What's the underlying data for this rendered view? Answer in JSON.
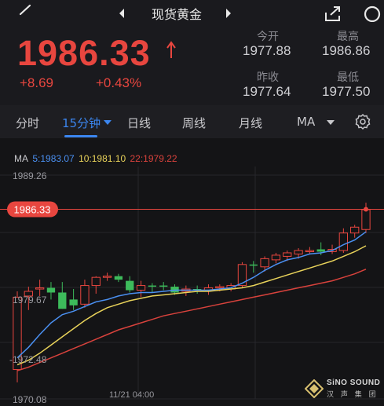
{
  "header": {
    "title": "现货黄金"
  },
  "quote": {
    "price": "1986.33",
    "change": "+8.69",
    "change_pct": "+0.43%",
    "stats": [
      {
        "label": "今开",
        "value": "1977.88"
      },
      {
        "label": "最高",
        "value": "1986.86"
      },
      {
        "label": "昨收",
        "value": "1977.64"
      },
      {
        "label": "最低",
        "value": "1977.50"
      }
    ]
  },
  "tabs": {
    "items": [
      "分时",
      "15分钟",
      "日线",
      "周线",
      "月线",
      "MA"
    ],
    "active": "15分钟"
  },
  "colors": {
    "up": "#e8463f",
    "down": "#3dbb5b",
    "accent": "#3b86f0",
    "ma5": "#4a8ff0",
    "ma10": "#e8d25a",
    "ma22": "#d8423c"
  },
  "ma_legend": {
    "ma_label": "MA",
    "ma5": "5:1983.07",
    "ma10": "10:1981.10",
    "ma22": "22:1979.22"
  },
  "chart_data": {
    "type": "candlestick",
    "y_ticks": [
      "1989.26",
      "1979.67",
      "1972.48",
      "1970.08"
    ],
    "x_ticks": [
      "11/21 04:00"
    ],
    "last_price_label": "1986.33",
    "last_price": 1986.33,
    "ylim": [
      1970.08,
      1989.26
    ],
    "candles": [
      {
        "open": 1972.6,
        "high": 1979.3,
        "low": 1971.5,
        "close": 1978.8
      },
      {
        "open": 1978.9,
        "high": 1979.7,
        "low": 1977.7,
        "close": 1979.3
      },
      {
        "open": 1979.5,
        "high": 1980.3,
        "low": 1978.9,
        "close": 1979.6
      },
      {
        "open": 1979.6,
        "high": 1980.1,
        "low": 1978.6,
        "close": 1979.2
      },
      {
        "open": 1979.2,
        "high": 1980.1,
        "low": 1977.8,
        "close": 1977.8
      },
      {
        "open": 1978.6,
        "high": 1979.5,
        "low": 1977.7,
        "close": 1978.1
      },
      {
        "open": 1978.2,
        "high": 1980.3,
        "low": 1977.9,
        "close": 1979.8
      },
      {
        "open": 1979.8,
        "high": 1980.6,
        "low": 1979.1,
        "close": 1980.5
      },
      {
        "open": 1980.5,
        "high": 1980.9,
        "low": 1980.2,
        "close": 1980.6
      },
      {
        "open": 1980.6,
        "high": 1980.8,
        "low": 1980.1,
        "close": 1980.3
      },
      {
        "open": 1980.2,
        "high": 1980.6,
        "low": 1979.2,
        "close": 1979.4
      },
      {
        "open": 1979.4,
        "high": 1980.2,
        "low": 1978.8,
        "close": 1979.8
      },
      {
        "open": 1979.8,
        "high": 1980.0,
        "low": 1979.2,
        "close": 1979.7
      },
      {
        "open": 1979.8,
        "high": 1980.1,
        "low": 1979.4,
        "close": 1979.7
      },
      {
        "open": 1979.7,
        "high": 1979.9,
        "low": 1979.0,
        "close": 1979.2
      },
      {
        "open": 1979.3,
        "high": 1979.8,
        "low": 1978.9,
        "close": 1979.5
      },
      {
        "open": 1979.5,
        "high": 1979.8,
        "low": 1979.1,
        "close": 1979.4
      },
      {
        "open": 1979.4,
        "high": 1979.9,
        "low": 1979.0,
        "close": 1979.6
      },
      {
        "open": 1979.6,
        "high": 1979.9,
        "low": 1979.3,
        "close": 1979.7
      },
      {
        "open": 1979.5,
        "high": 1980.0,
        "low": 1979.3,
        "close": 1979.8
      },
      {
        "open": 1979.8,
        "high": 1981.8,
        "low": 1979.6,
        "close": 1981.6
      },
      {
        "open": 1981.6,
        "high": 1981.9,
        "low": 1980.9,
        "close": 1981.5
      },
      {
        "open": 1981.4,
        "high": 1982.3,
        "low": 1981.0,
        "close": 1982.1
      },
      {
        "open": 1982.0,
        "high": 1982.6,
        "low": 1981.7,
        "close": 1982.4
      },
      {
        "open": 1982.3,
        "high": 1982.8,
        "low": 1981.9,
        "close": 1982.6
      },
      {
        "open": 1982.5,
        "high": 1983.0,
        "low": 1982.1,
        "close": 1982.8
      },
      {
        "open": 1982.7,
        "high": 1983.1,
        "low": 1982.5,
        "close": 1982.8
      },
      {
        "open": 1982.9,
        "high": 1983.5,
        "low": 1982.4,
        "close": 1982.7
      },
      {
        "open": 1982.7,
        "high": 1983.3,
        "low": 1982.5,
        "close": 1982.9
      },
      {
        "open": 1982.8,
        "high": 1984.7,
        "low": 1982.6,
        "close": 1984.3
      },
      {
        "open": 1984.3,
        "high": 1985.0,
        "low": 1983.9,
        "close": 1984.8
      },
      {
        "open": 1984.6,
        "high": 1986.9,
        "low": 1984.3,
        "close": 1986.3
      }
    ],
    "ma_series": [
      {
        "name": "MA5",
        "values": [
          1973.6,
          1974.5,
          1975.6,
          1976.6,
          1977.3,
          1977.6,
          1978.0,
          1978.4,
          1978.6,
          1978.9,
          1979.1,
          1979.2,
          1979.2,
          1979.3,
          1979.4,
          1979.4,
          1979.4,
          1979.4,
          1979.5,
          1979.6,
          1980.0,
          1980.5,
          1981.1,
          1981.6,
          1982.0,
          1982.2,
          1982.5,
          1982.6,
          1982.8,
          1983.3,
          1983.7,
          1984.4
        ]
      },
      {
        "name": "MA10",
        "values": [
          1973.0,
          1973.4,
          1974.0,
          1974.7,
          1975.4,
          1976.1,
          1976.8,
          1977.4,
          1977.9,
          1978.2,
          1978.5,
          1978.7,
          1978.9,
          1979.0,
          1979.1,
          1979.2,
          1979.3,
          1979.3,
          1979.4,
          1979.5,
          1979.6,
          1979.8,
          1980.1,
          1980.4,
          1980.7,
          1981.0,
          1981.3,
          1981.6,
          1981.9,
          1982.3,
          1982.7,
          1983.2
        ]
      },
      {
        "name": "MA22",
        "values": [
          1972.5,
          1972.8,
          1973.2,
          1973.6,
          1974.0,
          1974.4,
          1974.8,
          1975.2,
          1975.6,
          1976.0,
          1976.3,
          1976.6,
          1976.9,
          1977.2,
          1977.4,
          1977.6,
          1977.8,
          1978.0,
          1978.2,
          1978.4,
          1978.6,
          1978.8,
          1979.0,
          1979.2,
          1979.4,
          1979.6,
          1979.8,
          1980.0,
          1980.2,
          1980.5,
          1980.8,
          1981.2
        ]
      }
    ]
  },
  "watermark": {
    "line1": "SiNO SOUND",
    "line2": "汉 声 集 团"
  }
}
